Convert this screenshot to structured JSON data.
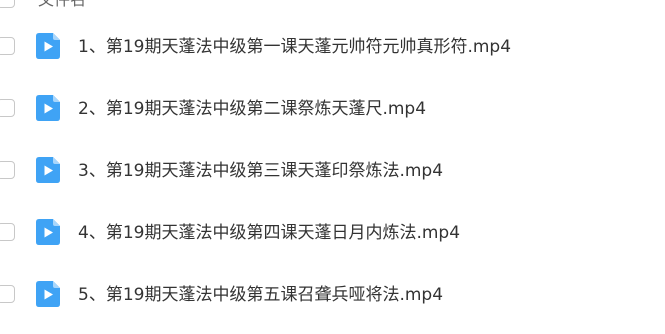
{
  "header": {
    "label": "文件名"
  },
  "files": [
    {
      "icon": "video-file-icon",
      "name": "1、第19期天蓬法中级第一课天蓬元帅符元帅真形符.mp4"
    },
    {
      "icon": "video-file-icon",
      "name": "2、第19期天蓬法中级第二课祭炼天蓬尺.mp4"
    },
    {
      "icon": "video-file-icon",
      "name": "3、第19期天蓬法中级第三课天蓬印祭炼法.mp4"
    },
    {
      "icon": "video-file-icon",
      "name": "4、第19期天蓬法中级第四课天蓬日月内炼法.mp4"
    },
    {
      "icon": "video-file-icon",
      "name": "5、第19期天蓬法中级第五课召聋兵哑将法.mp4"
    }
  ],
  "colors": {
    "icon_blue": "#3fa3f5",
    "icon_fold": "#a9d6fb",
    "checkbox_border": "#c8c8c8",
    "text": "#333333"
  }
}
